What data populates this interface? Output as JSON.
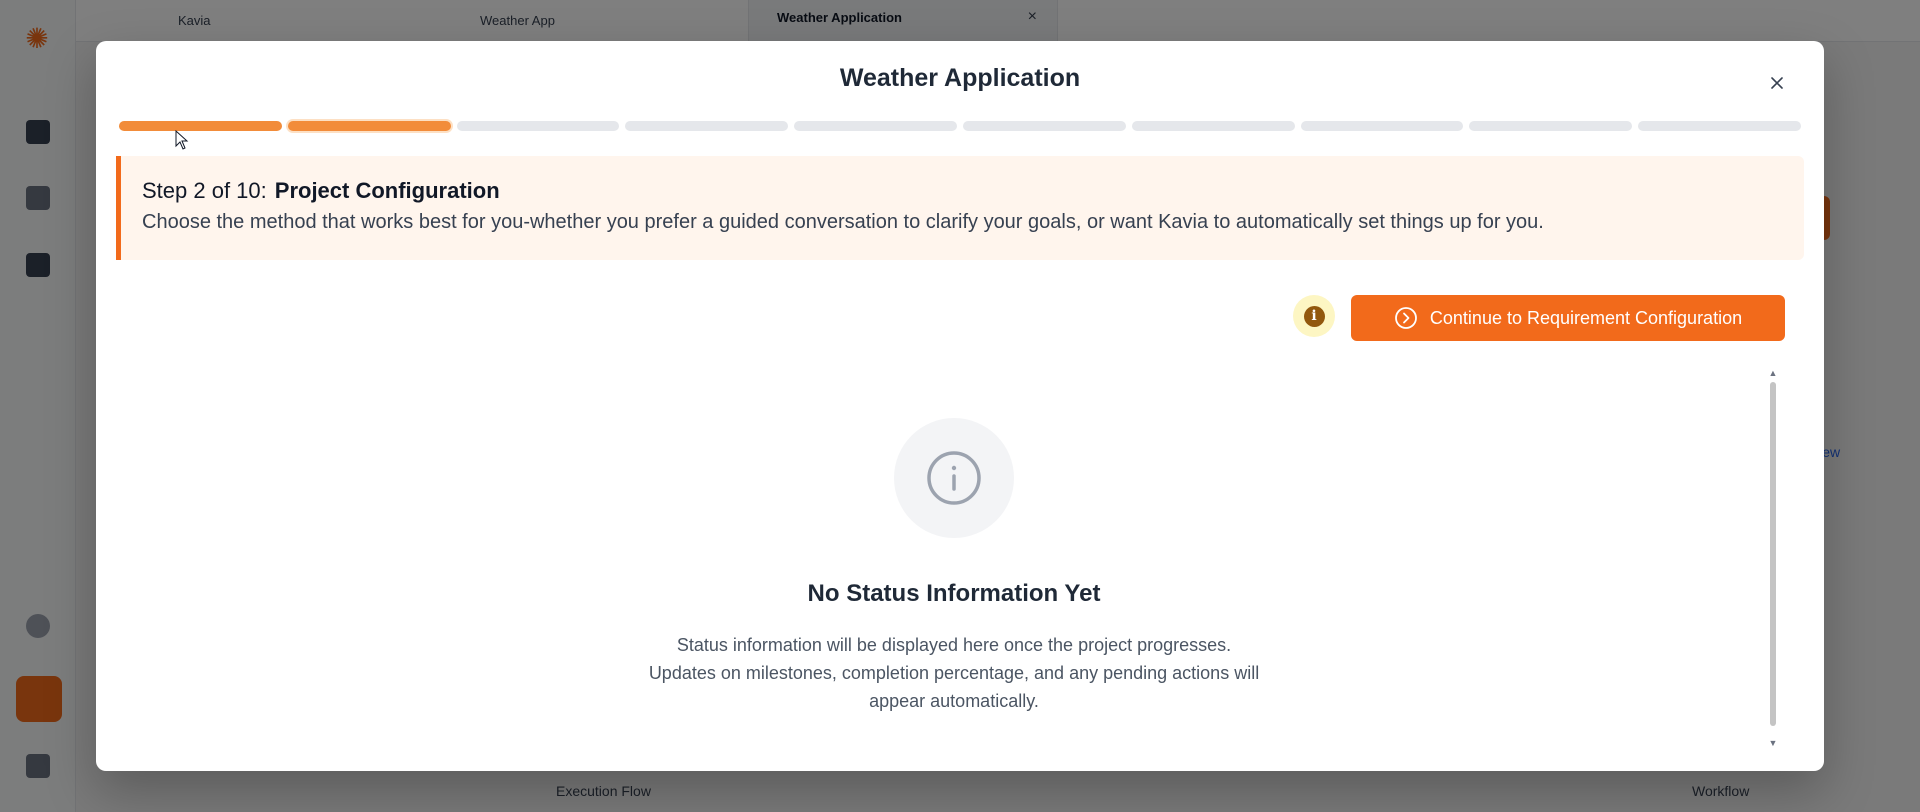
{
  "background": {
    "topbar_left": "Kavia",
    "topbar_middle": "Weather App",
    "tab_title": "Weather Application",
    "tab_close": "×",
    "bottom_left": "Execution Flow",
    "bottom_right": "Workflow",
    "side_link": "View"
  },
  "modal": {
    "title": "Weather Application",
    "close_icon": "close-icon",
    "stepper": {
      "total_steps": 10,
      "current_step": 2,
      "steps": [
        "done",
        "current",
        "pending",
        "pending",
        "pending",
        "pending",
        "pending",
        "pending",
        "pending",
        "pending"
      ]
    },
    "banner": {
      "step_label": "Step 2 of 10:",
      "step_name": "Project Configuration",
      "description": "Choose the method that works best for you-whether you prefer a guided conversation to clarify your goals, or want Kavia to automatically set things up for you."
    },
    "actions": {
      "info_icon": "info-icon",
      "continue_label": "Continue to Requirement Configuration"
    },
    "empty_state": {
      "icon": "info-circle-icon",
      "title": "No Status Information Yet",
      "lines": [
        "Status information will be displayed here once the project progresses.",
        "Updates on milestones, completion percentage, and any pending actions will",
        "appear automatically."
      ]
    }
  },
  "colors": {
    "accent": "#f26a1b",
    "progress_done": "#f28c3a",
    "progress_pending": "#e5e7eb",
    "banner_bg": "#fff5ed"
  }
}
